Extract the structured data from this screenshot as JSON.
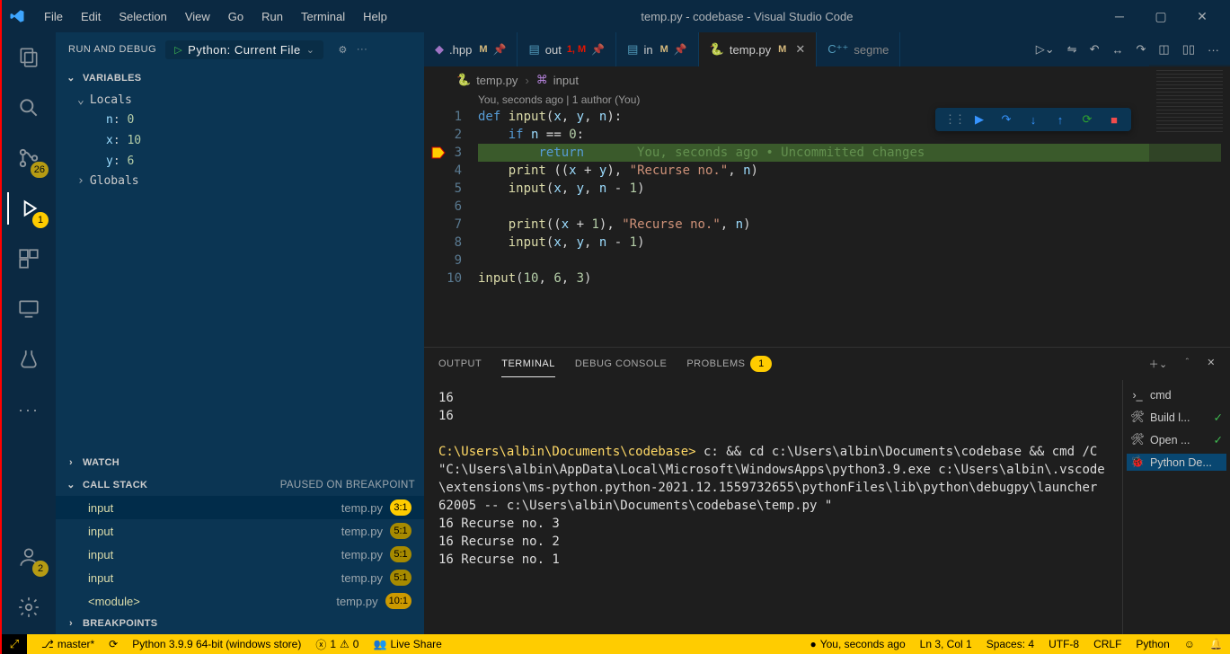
{
  "title": "temp.py - codebase - Visual Studio Code",
  "menu": [
    "File",
    "Edit",
    "Selection",
    "View",
    "Go",
    "Run",
    "Terminal",
    "Help"
  ],
  "activity": {
    "scm_badge": "26",
    "debug_badge": "1",
    "accounts_badge": "2"
  },
  "sidebar": {
    "title": "RUN AND DEBUG",
    "config": "Python: Current File",
    "variables_label": "VARIABLES",
    "locals_label": "Locals",
    "globals_label": "Globals",
    "vars": [
      {
        "key": "n",
        "val": "0"
      },
      {
        "key": "x",
        "val": "10"
      },
      {
        "key": "y",
        "val": "6"
      }
    ],
    "watch_label": "WATCH",
    "callstack_label": "CALL STACK",
    "callstack_status": "PAUSED ON BREAKPOINT",
    "stack": [
      {
        "fn": "input",
        "file": "temp.py",
        "pos": "3:1",
        "active": true
      },
      {
        "fn": "input",
        "file": "temp.py",
        "pos": "5:1"
      },
      {
        "fn": "input",
        "file": "temp.py",
        "pos": "5:1"
      },
      {
        "fn": "input",
        "file": "temp.py",
        "pos": "5:1"
      },
      {
        "fn": "<module>",
        "file": "temp.py",
        "pos": "10:1"
      }
    ],
    "breakpoints_label": "BREAKPOINTS"
  },
  "tabs": [
    {
      "name": ".hpp",
      "mod": "M",
      "pinned": true,
      "icon": "cpp"
    },
    {
      "name": "out",
      "mod": "1, M",
      "pinned": true,
      "icon": "doc",
      "git": true
    },
    {
      "name": "in",
      "mod": "M",
      "pinned": true,
      "icon": "doc"
    },
    {
      "name": "temp.py",
      "mod": "M",
      "active": true,
      "close": true,
      "icon": "py"
    },
    {
      "name": "segme",
      "faded": true,
      "icon": "cpp-blue"
    }
  ],
  "breadcrumb": {
    "file": "temp.py",
    "sym": "input"
  },
  "codelens": "You, seconds ago | 1 author (You)",
  "code": {
    "hl_line": 3,
    "inline_blame": "You, seconds ago • Uncommitted changes",
    "lines": [
      "def input(x, y, n):",
      "    if n == 0:",
      "        return",
      "    print ((x + y), \"Recurse no.\", n)",
      "    input(x, y, n - 1)",
      "",
      "    print((x + 1), \"Recurse no.\", n)",
      "    input(x, y, n - 1)",
      "",
      "input(10, 6, 3)"
    ]
  },
  "panel": {
    "tabs": {
      "output": "OUTPUT",
      "terminal": "TERMINAL",
      "debug": "DEBUG CONSOLE",
      "problems": "PROBLEMS",
      "problems_badge": "1"
    },
    "terminal_sessions": [
      {
        "label": "cmd",
        "icon": "›_"
      },
      {
        "label": "Build l...",
        "icon": "🛠",
        "check": true
      },
      {
        "label": "Open ...",
        "icon": "🛠",
        "check": true
      },
      {
        "label": "Python De...",
        "icon": "🐞",
        "active": true
      }
    ],
    "terminal_text": "16\n16\n\nC:\\Users\\albin\\Documents\\codebase> c: && cd c:\\Users\\albin\\Documents\\codebase && cmd /C \"C:\\Users\\albin\\AppData\\Local\\Microsoft\\WindowsApps\\python3.9.exe c:\\Users\\albin\\.vscode\\extensions\\ms-python.python-2021.12.1559732655\\pythonFiles\\lib\\python\\debugpy\\launcher 62005 -- c:\\Users\\albin\\Documents\\codebase\\temp.py \"\n16 Recurse no. 3\n16 Recurse no. 2\n16 Recurse no. 1"
  },
  "status": {
    "branch": "master*",
    "interpreter": "Python 3.9.9 64-bit (windows store)",
    "errors": "1",
    "warnings": "0",
    "liveshare": "Live Share",
    "blame": "You, seconds ago",
    "pos": "Ln 3, Col 1",
    "spaces": "Spaces: 4",
    "encoding": "UTF-8",
    "eol": "CRLF",
    "lang": "Python"
  }
}
